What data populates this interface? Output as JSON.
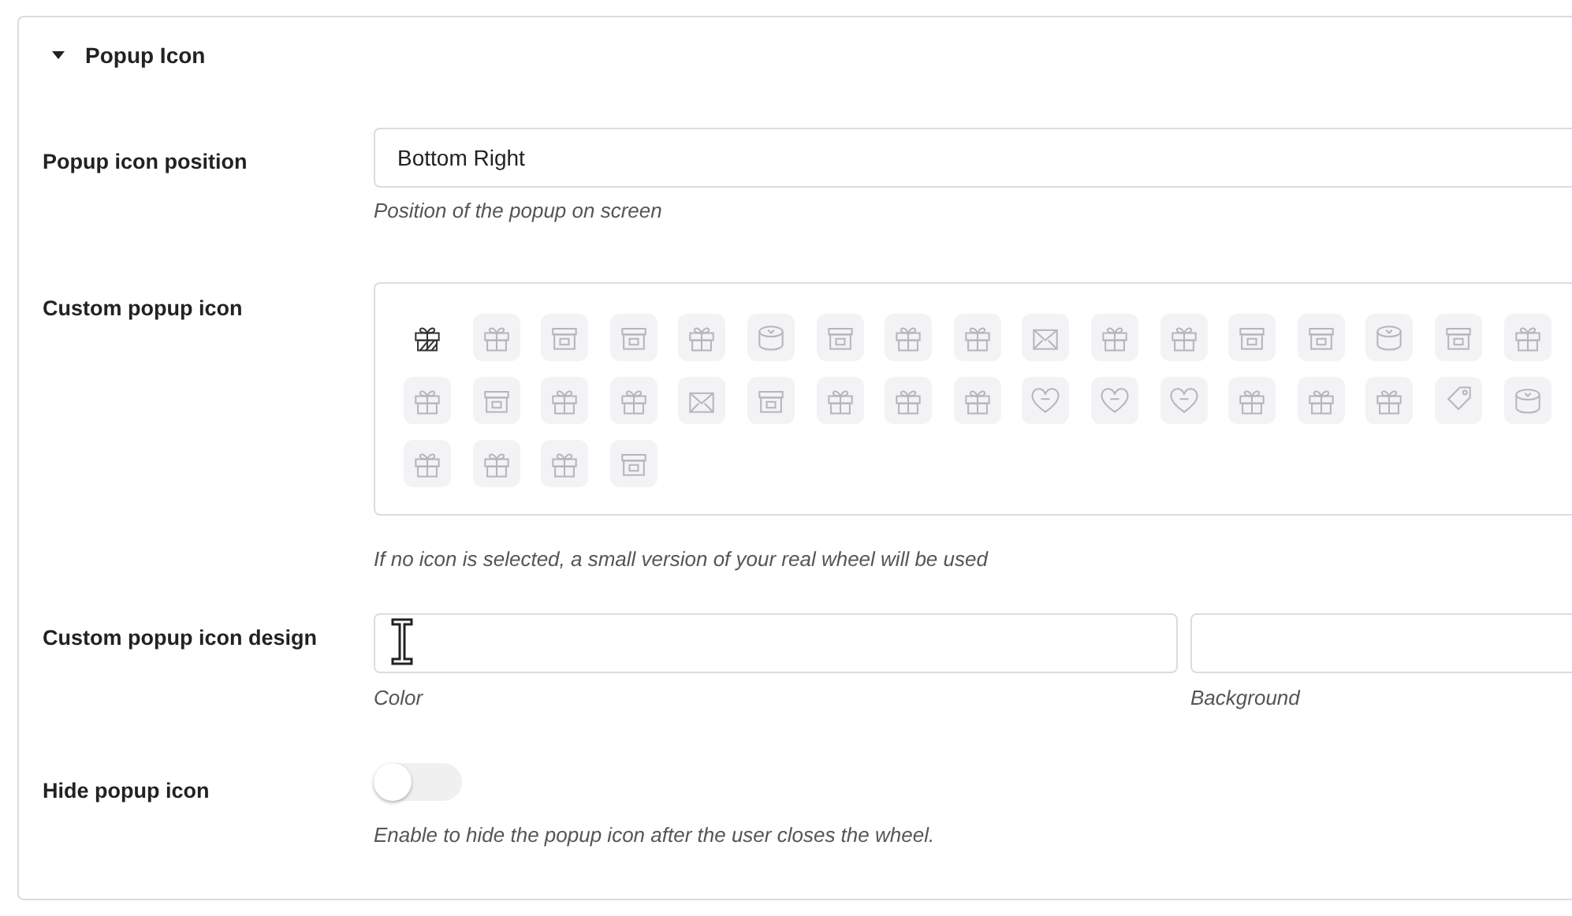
{
  "section": {
    "title": "Popup Icon",
    "expanded": true
  },
  "position": {
    "label": "Popup icon position",
    "value": "Bottom Right",
    "help": "Position of the popup on screen"
  },
  "custom_icon": {
    "label": "Custom popup icon",
    "help": "If no icon is selected, a small version of your real wheel will be used",
    "icons": [
      {
        "kind": "gift",
        "selected": true
      },
      {
        "kind": "gift",
        "selected": false
      },
      {
        "kind": "box",
        "selected": false
      },
      {
        "kind": "box",
        "selected": false
      },
      {
        "kind": "gift",
        "selected": false
      },
      {
        "kind": "round",
        "selected": false
      },
      {
        "kind": "box",
        "selected": false
      },
      {
        "kind": "gift",
        "selected": false
      },
      {
        "kind": "gift",
        "selected": false
      },
      {
        "kind": "envelope",
        "selected": false
      },
      {
        "kind": "gift",
        "selected": false
      },
      {
        "kind": "gift",
        "selected": false
      },
      {
        "kind": "box",
        "selected": false
      },
      {
        "kind": "box",
        "selected": false
      },
      {
        "kind": "round",
        "selected": false
      },
      {
        "kind": "box",
        "selected": false
      },
      {
        "kind": "gift",
        "selected": false
      },
      {
        "kind": "gift",
        "selected": false
      },
      {
        "kind": "box",
        "selected": false
      },
      {
        "kind": "gift",
        "selected": false
      },
      {
        "kind": "gift",
        "selected": false
      },
      {
        "kind": "envelope",
        "selected": false
      },
      {
        "kind": "box",
        "selected": false
      },
      {
        "kind": "gift",
        "selected": false
      },
      {
        "kind": "gift",
        "selected": false
      },
      {
        "kind": "gift",
        "selected": false
      },
      {
        "kind": "heart",
        "selected": false
      },
      {
        "kind": "heart",
        "selected": false
      },
      {
        "kind": "heart",
        "selected": false
      },
      {
        "kind": "gift",
        "selected": false
      },
      {
        "kind": "gift",
        "selected": false
      },
      {
        "kind": "gift",
        "selected": false
      },
      {
        "kind": "tag",
        "selected": false
      },
      {
        "kind": "round",
        "selected": false
      },
      {
        "kind": "gift",
        "selected": false
      },
      {
        "kind": "gift",
        "selected": false
      },
      {
        "kind": "gift",
        "selected": false
      },
      {
        "kind": "box",
        "selected": false
      }
    ]
  },
  "design": {
    "label": "Custom popup icon design",
    "fields": [
      {
        "caption": "Color"
      },
      {
        "caption": "Background"
      }
    ]
  },
  "hide": {
    "label": "Hide popup icon",
    "on": false,
    "help": "Enable to hide the popup icon after the user closes the wheel."
  }
}
